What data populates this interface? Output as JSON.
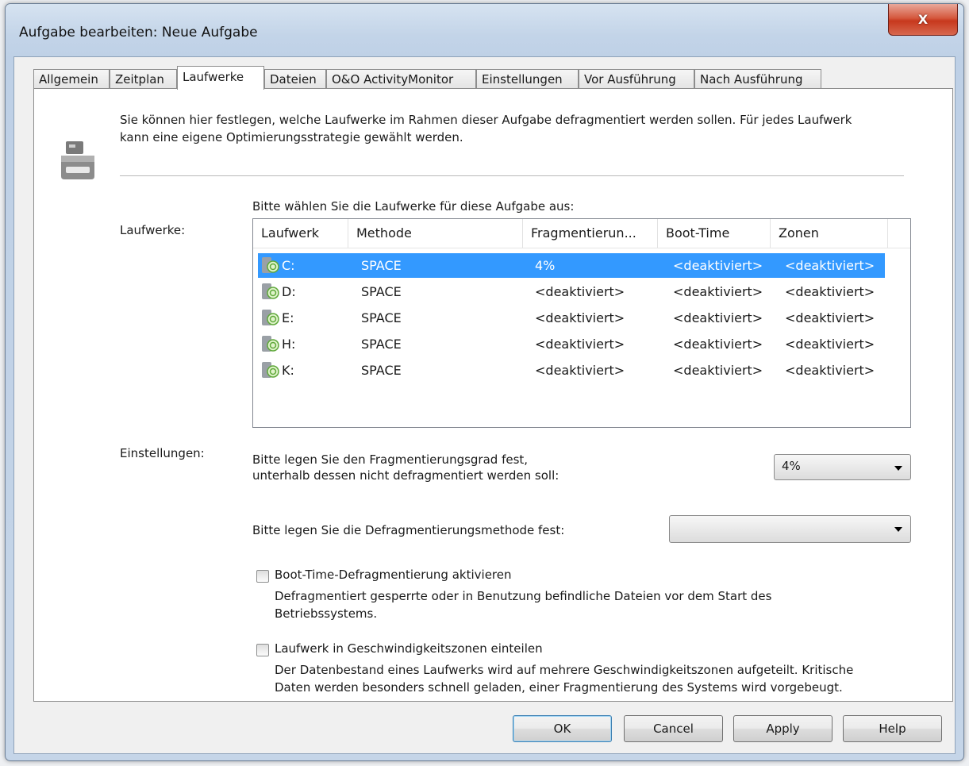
{
  "window": {
    "title": "Aufgabe bearbeiten: Neue Aufgabe",
    "close_label": "X"
  },
  "tabs": [
    {
      "label": "Allgemein"
    },
    {
      "label": "Zeitplan"
    },
    {
      "label": "Laufwerke"
    },
    {
      "label": "Dateien"
    },
    {
      "label": "O&O ActivityMonitor"
    },
    {
      "label": "Einstellungen"
    },
    {
      "label": "Vor Ausführung"
    },
    {
      "label": "Nach Ausführung"
    }
  ],
  "active_tab": "Laufwerke",
  "intro_text": "Sie können hier festlegen, welche Laufwerke im Rahmen dieser Aufgabe defragmentiert werden sollen. Für jedes Laufwerk kann eine eigene Optimierungsstrategie gewählt werden.",
  "drives_section": {
    "label": "Laufwerke:",
    "prompt": "Bitte wählen Sie die Laufwerke für diese Aufgabe aus:",
    "columns": [
      "Laufwerk",
      "Methode",
      "Fragmentierun...",
      "Boot-Time",
      "Zonen"
    ],
    "rows": [
      {
        "drive": "C:",
        "method": "SPACE",
        "frag": "4%",
        "boot": "<deaktiviert>",
        "zones": "<deaktiviert>",
        "selected": true
      },
      {
        "drive": "D:",
        "method": "SPACE",
        "frag": "<deaktiviert>",
        "boot": "<deaktiviert>",
        "zones": "<deaktiviert>",
        "selected": false
      },
      {
        "drive": "E:",
        "method": "SPACE",
        "frag": "<deaktiviert>",
        "boot": "<deaktiviert>",
        "zones": "<deaktiviert>",
        "selected": false
      },
      {
        "drive": "H:",
        "method": "SPACE",
        "frag": "<deaktiviert>",
        "boot": "<deaktiviert>",
        "zones": "<deaktiviert>",
        "selected": false
      },
      {
        "drive": "K:",
        "method": "SPACE",
        "frag": "<deaktiviert>",
        "boot": "<deaktiviert>",
        "zones": "<deaktiviert>",
        "selected": false
      }
    ]
  },
  "settings_section": {
    "label": "Einstellungen:",
    "frag_prompt_line1": "Bitte legen Sie den Fragmentierungsgrad fest,",
    "frag_prompt_line2": "unterhalb dessen nicht defragmentiert werden soll:",
    "frag_value": "4%",
    "method_prompt": "Bitte legen Sie die Defragmentierungsmethode fest:",
    "method_value": "",
    "boot_time_checkbox": {
      "label": "Boot-Time-Defragmentierung aktivieren",
      "checked": false,
      "desc_line1": "Defragmentiert gesperrte oder in Benutzung befindliche Dateien vor dem Start des",
      "desc_line2": "Betriebssystems."
    },
    "zones_checkbox": {
      "label": "Laufwerk in Geschwindigkeitszonen einteilen",
      "checked": false,
      "desc_line1": "Der Datenbestand eines Laufwerks wird auf mehrere Geschwindigkeitszonen aufgeteilt. Kritische",
      "desc_line2": "Daten werden besonders schnell geladen, einer Fragmentierung des Systems wird vorgebeugt."
    }
  },
  "buttons": {
    "ok": "OK",
    "cancel": "Cancel",
    "apply": "Apply",
    "help": "Help"
  },
  "colors": {
    "selection": "#3399ff",
    "close_button": "#c7381d"
  }
}
